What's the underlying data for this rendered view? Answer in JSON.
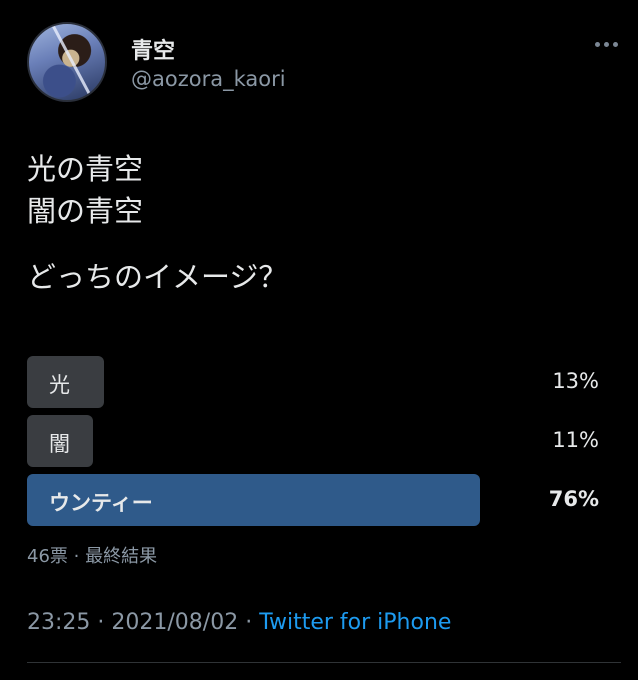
{
  "header": {
    "display_name": "青空",
    "handle": "@aozora_kaori"
  },
  "tweet": {
    "lines": [
      "光の青空",
      "闇の青空",
      "どっちのイメージ？"
    ]
  },
  "poll": {
    "options": [
      {
        "label": "光",
        "percent_text": "13%",
        "percent": 13,
        "winner": false
      },
      {
        "label": "闇",
        "percent_text": "11%",
        "percent": 11,
        "winner": false
      },
      {
        "label": "ウンティー",
        "percent_text": "76%",
        "percent": 76,
        "winner": true
      }
    ],
    "meta": "46票 · 最終結果"
  },
  "footer": {
    "time": "23:25",
    "sep1": " · ",
    "date": "2021/08/02",
    "sep2": " · ",
    "source": "Twitter for iPhone"
  },
  "colors": {
    "background": "#000000",
    "text": "#e7e9ea",
    "muted": "#8b98a5",
    "poll_bar": "#3a3d41",
    "poll_bar_winner": "#2f5a8a",
    "link": "#1d9bf0"
  },
  "icons": {
    "more": "more-dots-icon",
    "avatar": "avatar"
  }
}
